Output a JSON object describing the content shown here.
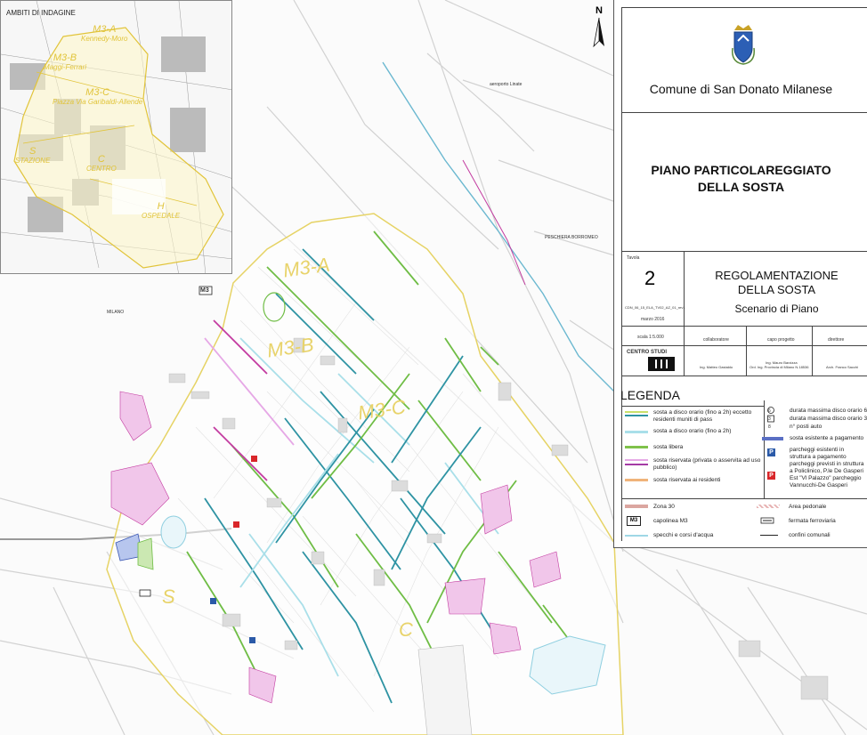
{
  "map": {
    "labels": {
      "aeroporto": "aeroporto Linate",
      "peschiera": "PESCHIERA BORROMEO",
      "milano": "MILANO",
      "m3": "M3"
    },
    "zones": {
      "m3a": "M3-A",
      "m3b": "M3-B",
      "m3c": "M3-C",
      "s": "S",
      "c": "C"
    }
  },
  "inset": {
    "title": "AMBITI DI INDAGINE",
    "zones": [
      {
        "code": "M3-A",
        "name": "Kennedy-Moro"
      },
      {
        "code": "M3-B",
        "name": "Maggi-Ferrari"
      },
      {
        "code": "M3-C",
        "name": "Piazza Via Garibaldi-Allende"
      },
      {
        "code": "S",
        "name": "STAZIONE"
      },
      {
        "code": "C",
        "name": "CENTRO"
      },
      {
        "code": "H",
        "name": "OSPEDALE"
      }
    ]
  },
  "north": {
    "label": "N"
  },
  "panel": {
    "comune": "Comune di San Donato Milanese",
    "title_line1": "PIANO PARTICOLAREGGIATO",
    "title_line2": "DELLA SOSTA",
    "tavola_label": "Tavola",
    "tavola_number": "2",
    "code": "CDN_06_15_ELA_TV02_AZ_01_rev1",
    "date": "marzo 2016",
    "scale": "scala 1:5.000",
    "reg_line1": "REGOLAMENTAZIONE",
    "reg_line2": "DELLA SOSTA",
    "scenario": "Scenario di Piano",
    "roles": [
      "collaboratore",
      "capo progetto",
      "direttore"
    ],
    "names": [
      "Ing. Matteo Gastaldo",
      "Ing. Mauro Barzizza",
      "Ord. Ing. Provincia di Milano N.18536",
      "Arch. Franco Sacchi"
    ],
    "logo_text": "CENTRO STUDI"
  },
  "legend": {
    "title": "LEGENDA",
    "items": [
      {
        "text": "sosta a disco orario (fino a 2h) eccetto residenti muniti di pass",
        "color": "#c9e06a",
        "color2": "#2e93a3"
      },
      {
        "text": "sosta a disco orario (fino a 2h)",
        "color": "#a9dfe9"
      },
      {
        "text": "sosta libera",
        "color": "#7fc24a"
      },
      {
        "text": "sosta riservata (privata o asservita ad uso pubblico)",
        "color": "#e6a8e6",
        "color2": "#a53ba5"
      },
      {
        "text": "sosta riservata ai residenti",
        "color": "#f0b37a"
      },
      {
        "text": "durata massima disco orario 6",
        "icon": "6"
      },
      {
        "text": "durata massima disco orario 3",
        "icon": "3"
      },
      {
        "text": "n° posti auto",
        "icon": "8"
      },
      {
        "text": "sosta esistente a pagamento",
        "color": "#5a6fc4"
      },
      {
        "text": "parcheggi esistenti in struttura a pagamento",
        "icon": "P",
        "color": "#2b5aa8"
      },
      {
        "text": "parcheggi previsti in struttura a Policlinico, P.le De Gasperi Est \"Vl Palazzo\" parcheggio Vannucchi-De Gasperi",
        "icon": "P",
        "color": "#d9262a"
      },
      {
        "text": "Zona 30",
        "color": "#dba6a0"
      },
      {
        "text": "Area pedonale",
        "color": "#e7b3b3"
      },
      {
        "text": "capolinea M3",
        "icon": "M3"
      },
      {
        "text": "fermata ferroviaria"
      },
      {
        "text": "specchi e corsi d'acqua",
        "color": "#9fd7e6"
      },
      {
        "text": "confini comunali"
      }
    ]
  }
}
